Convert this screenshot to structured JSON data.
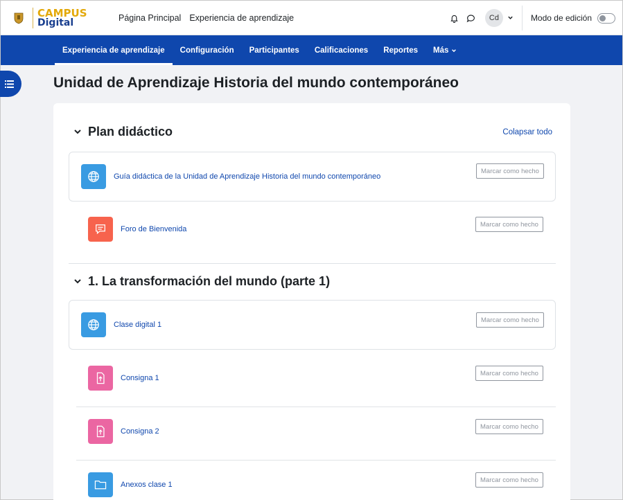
{
  "brand": {
    "top": "CAMPUS",
    "bottom": "Digital",
    "seal_text": "UNIVERSIDAD DE GUADALAJARA"
  },
  "topnav": {
    "home": "Página Principal",
    "experience": "Experiencia de aprendizaje"
  },
  "user": {
    "initials": "Cd"
  },
  "edit_mode": {
    "label": "Modo de edición",
    "enabled": false
  },
  "secnav": {
    "items": [
      {
        "label": "Experiencia de aprendizaje",
        "active": true
      },
      {
        "label": "Configuración",
        "active": false
      },
      {
        "label": "Participantes",
        "active": false
      },
      {
        "label": "Calificaciones",
        "active": false
      },
      {
        "label": "Reportes",
        "active": false
      },
      {
        "label": "Más",
        "active": false
      }
    ]
  },
  "page": {
    "title": "Unidad de Aprendizaje Historia del mundo contemporáneo"
  },
  "collapse_all": "Colapsar todo",
  "mark_done": "Marcar como hecho",
  "sections": [
    {
      "title": "Plan didáctico",
      "activities": [
        {
          "name": "Guía didáctica de la Unidad de Aprendizaje Historia del mundo contemporáneo",
          "type": "url",
          "icon": "globe-icon",
          "color": "#399be2"
        },
        {
          "name": "Foro de Bienvenida",
          "type": "forum",
          "icon": "forum-icon",
          "color": "#f7634d"
        }
      ]
    },
    {
      "title": "1. La transformación del mundo (parte 1)",
      "activities": [
        {
          "name": "Clase digital 1",
          "type": "url",
          "icon": "globe-icon",
          "color": "#399be2"
        },
        {
          "name": "Consigna 1",
          "type": "assign",
          "icon": "assignment-icon",
          "color": "#eb66a2"
        },
        {
          "name": "Consigna 2",
          "type": "assign",
          "icon": "assignment-icon",
          "color": "#eb66a2"
        },
        {
          "name": "Anexos clase 1",
          "type": "folder",
          "icon": "folder-icon",
          "color": "#399be2"
        }
      ]
    }
  ]
}
